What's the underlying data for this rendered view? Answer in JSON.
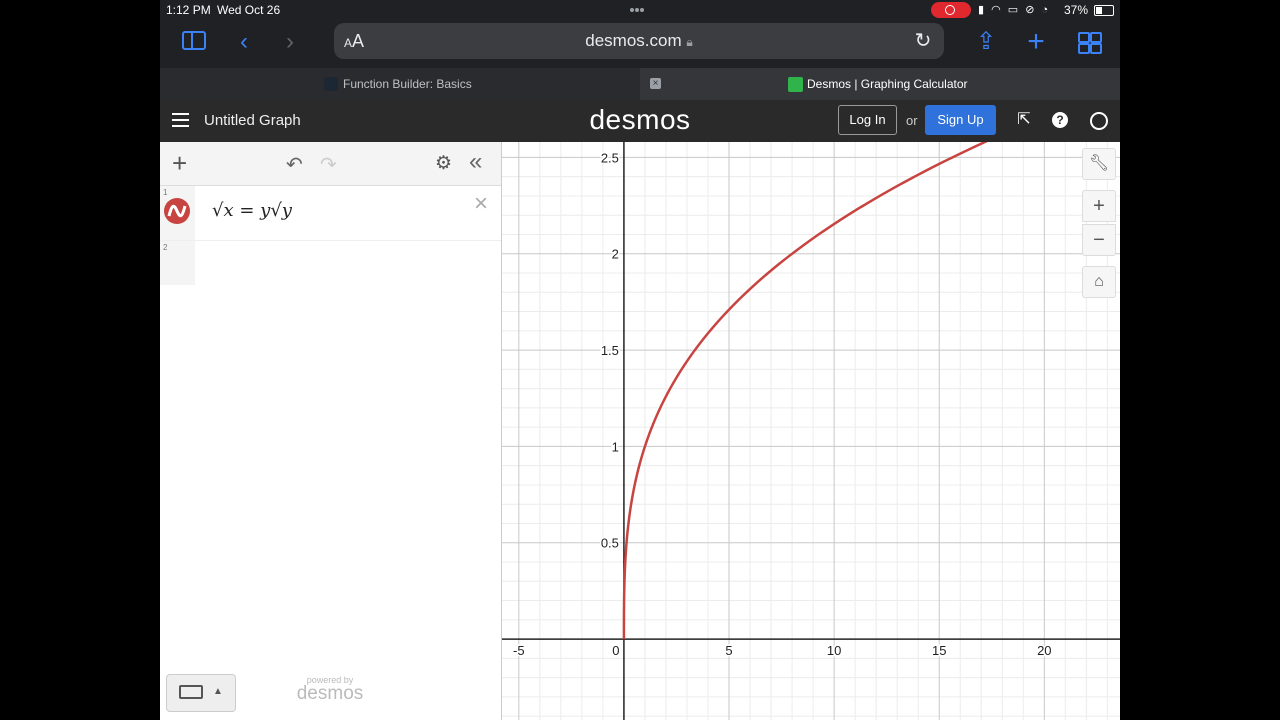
{
  "status": {
    "time": "1:12 PM",
    "date": "Wed Oct 26",
    "battery": "37%"
  },
  "browser": {
    "aa_label": "AA",
    "url": "desmos.com",
    "tabs": [
      {
        "title": "Function Builder: Basics",
        "active": false
      },
      {
        "title": "Desmos | Graphing Calculator",
        "active": true
      }
    ]
  },
  "app": {
    "graph_title": "Untitled Graph",
    "logo": "desmos",
    "login_label": "Log In",
    "or_label": "or",
    "signup_label": "Sign Up",
    "accent_color": "#2f72dc"
  },
  "expressions": [
    {
      "number": "1",
      "latex_display": "√x = y√y",
      "color": "#c74440"
    },
    {
      "number": "2",
      "latex_display": "",
      "color": ""
    }
  ],
  "footer": {
    "powered_by": "powered by",
    "brand": "desmos"
  },
  "icons": {
    "color_icon": "desmos-line-icon",
    "delete": "close-icon",
    "keyboard": "keyboard-icon"
  },
  "chart_data": {
    "type": "line",
    "series": [
      {
        "equation": "√x = y√y",
        "color": "#c74440",
        "x": [
          0,
          0.25,
          0.5,
          1,
          2,
          3,
          4,
          5,
          6,
          8,
          10,
          12,
          15,
          17.5
        ],
        "y": [
          0,
          0.63,
          0.79,
          1.0,
          1.26,
          1.44,
          1.59,
          1.71,
          1.82,
          2.0,
          2.15,
          2.29,
          2.47,
          2.6
        ]
      }
    ],
    "xlim": [
      -5.8,
      23.6
    ],
    "ylim": [
      -0.42,
      2.58
    ],
    "x_ticks": [
      -5,
      0,
      5,
      10,
      15,
      20
    ],
    "y_ticks": [
      0.5,
      1,
      1.5,
      2,
      2.5
    ],
    "x_tick_labels": [
      "-5",
      "0",
      "5",
      "10",
      "15",
      "20"
    ],
    "y_tick_labels": [
      "0.5",
      "1",
      "1.5",
      "2",
      "2.5"
    ],
    "grid": true,
    "minor_step_x": 1,
    "minor_step_y": 0.1
  }
}
